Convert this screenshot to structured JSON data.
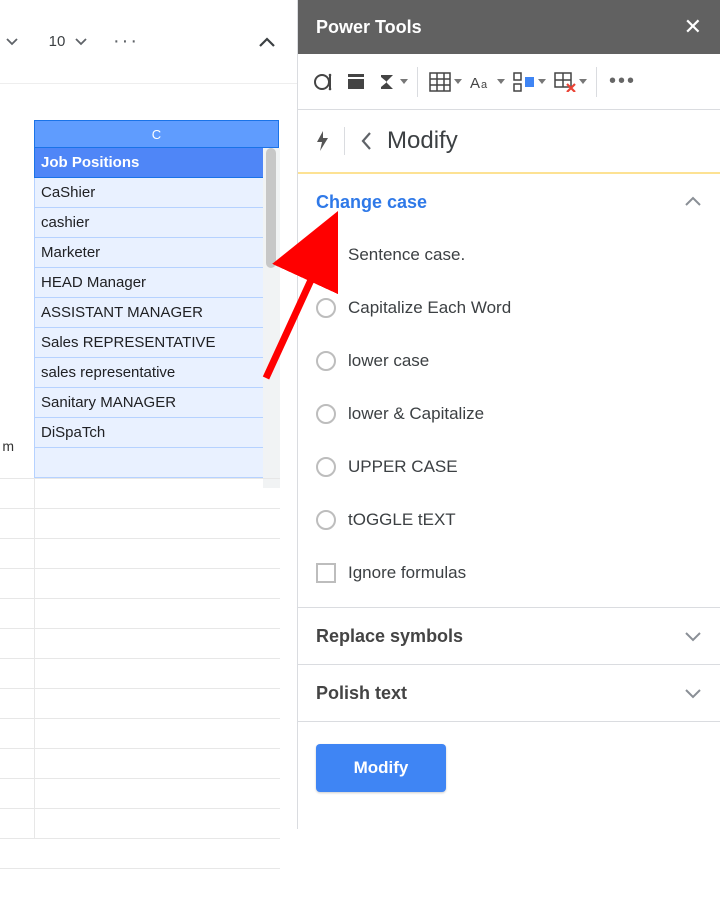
{
  "toolbar": {
    "font_size": "10",
    "more_label": "···"
  },
  "sheet": {
    "col_b_hint": "m",
    "column_letter": "C",
    "header": "Job Positions",
    "rows": [
      "CaShier",
      "cashier",
      "Marketer",
      "HEAD Manager",
      "ASSISTANT MANAGER",
      "Sales REPRESENTATIVE",
      "sales representative",
      "Sanitary MANAGER",
      "DiSpaTch"
    ]
  },
  "sidebar": {
    "title": "Power Tools",
    "nav_title": "Modify",
    "sections": {
      "change_case": {
        "title": "Change case",
        "options": [
          "Sentence case.",
          "Capitalize Each Word",
          "lower case",
          "lower & Capitalize",
          "UPPER CASE",
          "tOGGLE tEXT"
        ],
        "selected_index": 0,
        "ignore_formulas": "Ignore formulas"
      },
      "replace_symbols": {
        "title": "Replace symbols"
      },
      "polish_text": {
        "title": "Polish text"
      }
    },
    "run_button": "Modify"
  }
}
